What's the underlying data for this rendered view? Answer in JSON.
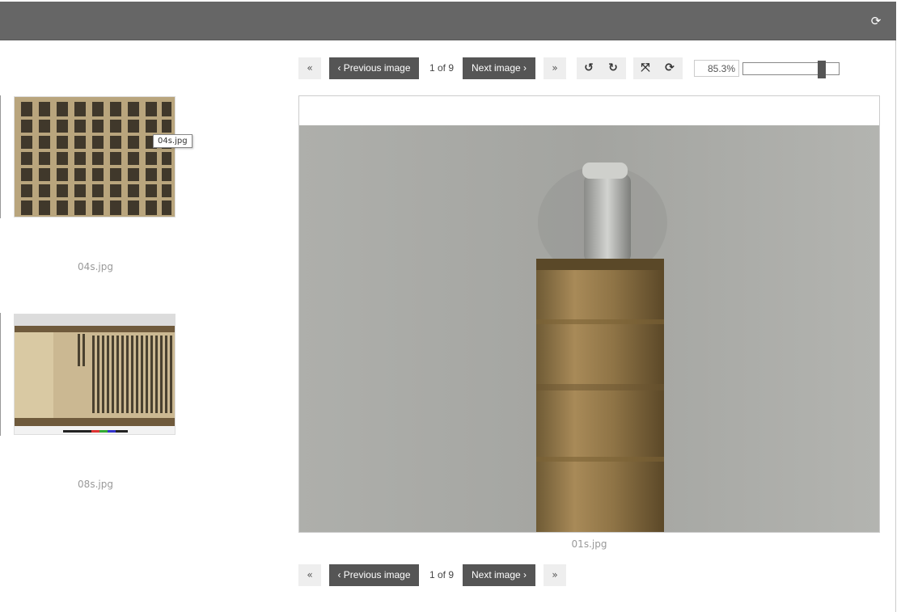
{
  "topbar": {
    "refresh_icon": "refresh-icon"
  },
  "thumbnails": [
    {
      "filename": "04s.jpg",
      "tooltip": "04s.jpg"
    },
    {
      "filename": "08s.jpg"
    }
  ],
  "nav": {
    "first_label": "«",
    "prev_label": "‹ Previous image",
    "counter": "1 of 9",
    "next_label": "Next image ›",
    "last_label": "»"
  },
  "tools": {
    "rotate_left_icon": "rotate-left-icon",
    "rotate_right_icon": "rotate-right-icon",
    "fit_icon": "fit-screen-icon",
    "reset_icon": "reset-icon",
    "zoom_value": "85.3%",
    "zoom_level": 0.853
  },
  "viewer": {
    "caption": "01s.jpg"
  },
  "colors": {
    "topbar": "#666666",
    "button_dark": "#555555",
    "button_light": "#eeeeee"
  }
}
